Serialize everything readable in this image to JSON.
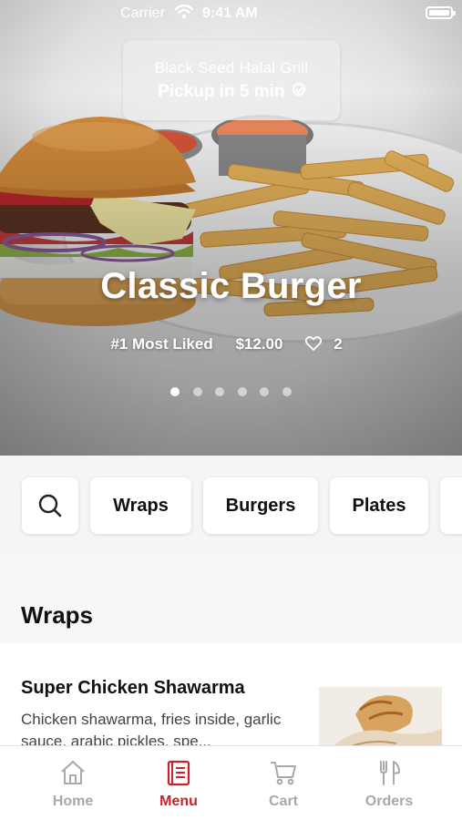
{
  "status_bar": {
    "carrier": "Carrier",
    "time": "9:41 AM"
  },
  "restaurant": {
    "name": "Black Seed Halal Grill",
    "pickup": "Pickup in 5 min"
  },
  "featured": {
    "title": "Classic Burger",
    "badge": "#1 Most Liked",
    "price": "$12.00",
    "likes": "2",
    "carousel_total": 6,
    "carousel_active": 1
  },
  "categories": {
    "items": [
      "Wraps",
      "Burgers",
      "Plates"
    ]
  },
  "section": {
    "title": "Wraps"
  },
  "menu_items": [
    {
      "name": "Super Chicken Shawarma",
      "description": "Chicken shawarma, fries inside, garlic sauce, arabic pickles, spe..."
    }
  ],
  "tabs": [
    {
      "label": "Home",
      "icon": "home-icon"
    },
    {
      "label": "Menu",
      "icon": "menu-icon",
      "active": true
    },
    {
      "label": "Cart",
      "icon": "cart-icon"
    },
    {
      "label": "Orders",
      "icon": "orders-icon"
    }
  ],
  "colors": {
    "accent": "#c9202a",
    "inactive_tab": "#a8a8a8"
  }
}
